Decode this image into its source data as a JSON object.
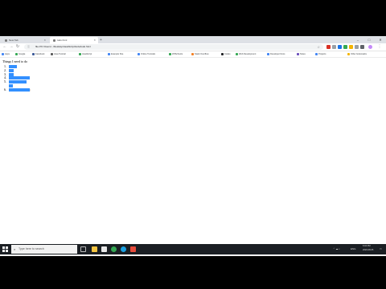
{
  "browser": {
    "tabs": [
      {
        "title": "New Tab",
        "active": false
      },
      {
        "title": "todo.html",
        "active": true
      }
    ],
    "url": "file:///C:/Users/.../Desktop/JavaScript/todo/todo.html",
    "bookmarks": [
      {
        "label": "Apps",
        "color": "#4285f4"
      },
      {
        "label": "Google",
        "color": "#34a853"
      },
      {
        "label": "Facebook",
        "color": "#3b5998"
      },
      {
        "label": "Java Tutorial",
        "color": "#5a5a5a"
      },
      {
        "label": "JavaScript",
        "color": "#34a853"
      },
      {
        "label": "Example Site",
        "color": "#4285f4"
      },
      {
        "label": "Online Tutorials",
        "color": "#4285f4"
      },
      {
        "label": "W3Schools",
        "color": "#34a853"
      },
      {
        "label": "Stack Overflow",
        "color": "#f48024"
      },
      {
        "label": "Codes",
        "color": "#202124"
      },
      {
        "label": "Web Development",
        "color": "#34a853"
      },
      {
        "label": "Developer Docs",
        "color": "#4285f4"
      },
      {
        "label": "Notes",
        "color": "#6b4fbb"
      },
      {
        "label": "Projects",
        "color": "#4285f4"
      },
      {
        "label": "Other bookmarks",
        "color": "#f4b400"
      }
    ]
  },
  "page": {
    "heading": "Things I need to do",
    "items": [
      {
        "num": "1."
      },
      {
        "num": "2."
      },
      {
        "num": "3."
      },
      {
        "num": "4."
      },
      {
        "num": "5."
      },
      {
        "num": "6."
      }
    ]
  },
  "taskbar": {
    "search_placeholder": "Type here to search",
    "time": "6:04 PM",
    "date": "2020-08-05",
    "lang": "ENG"
  },
  "colors": {
    "selection": "#3390ff",
    "taskbar": "#1b1f24"
  }
}
